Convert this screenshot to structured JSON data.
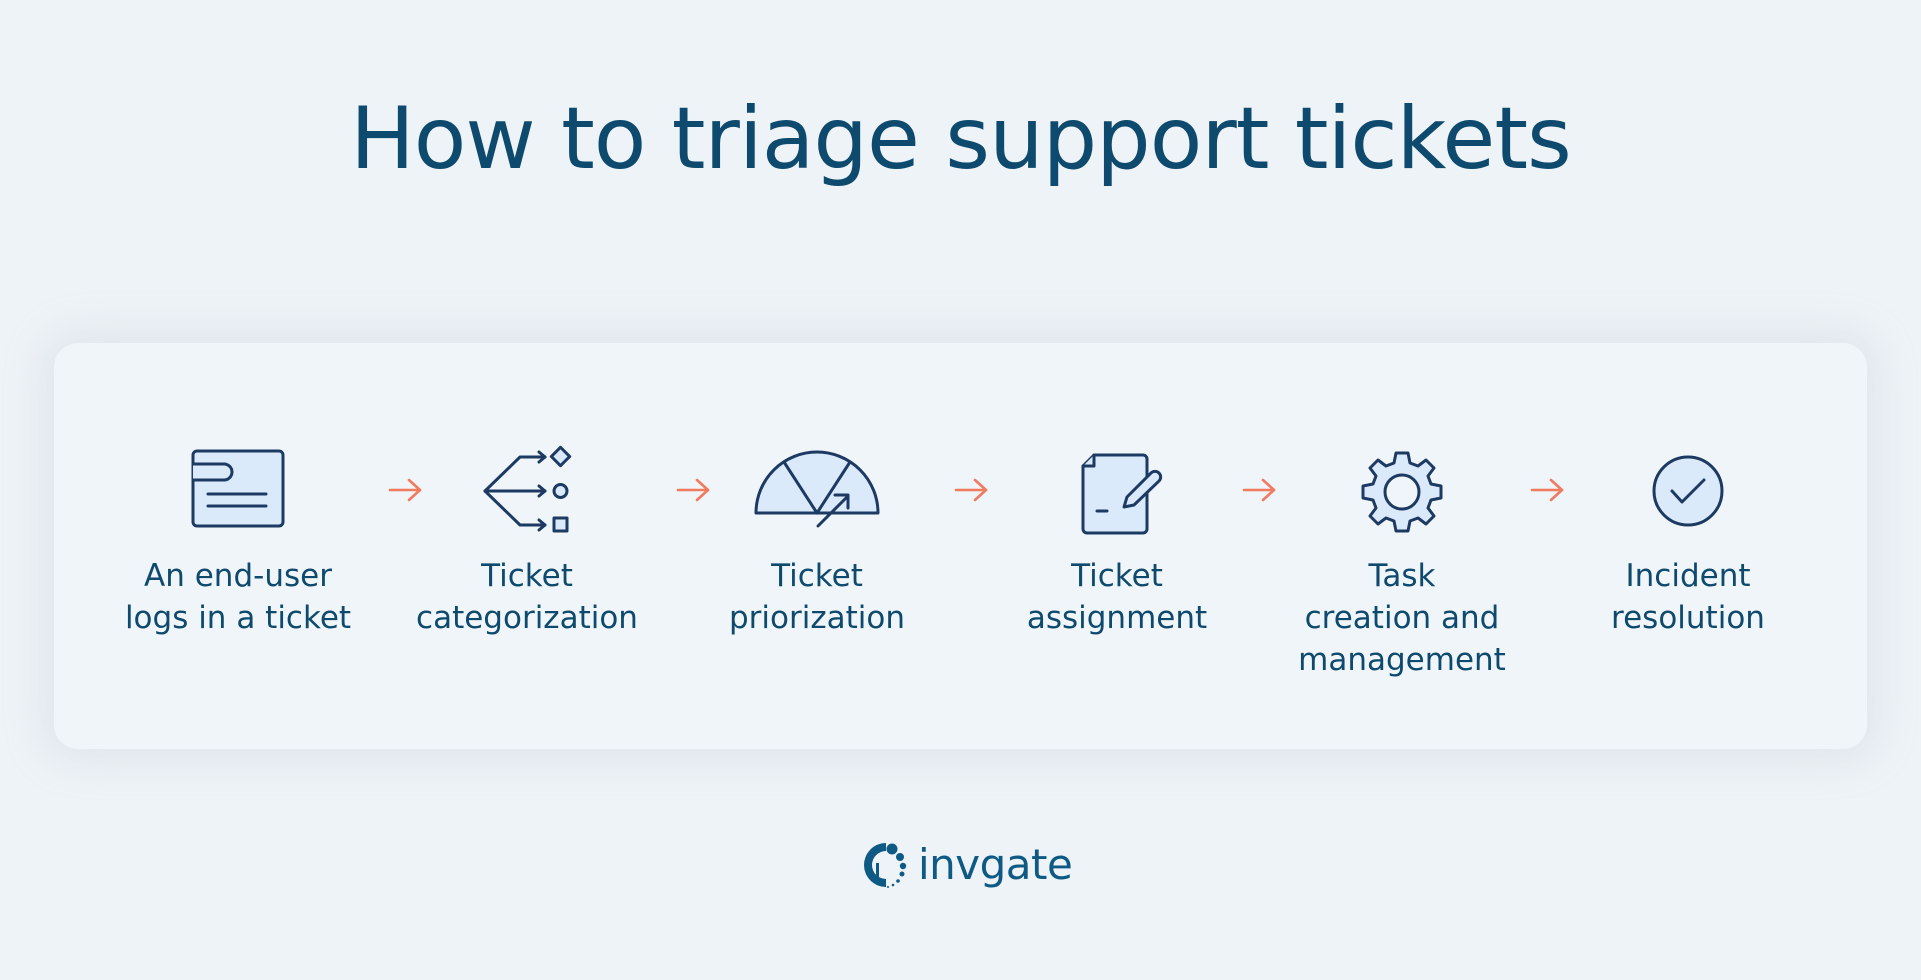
{
  "title": "How to triage support tickets",
  "colors": {
    "text": "#0e4a6e",
    "icon_stroke": "#1d3a63",
    "icon_fill": "#dbeafa",
    "arrow": "#f27a5e",
    "background": "#eef3f7",
    "card": "#f0f5f9",
    "brand": "#0e5a84"
  },
  "steps": [
    {
      "icon": "ticket-form-icon",
      "label": "An end-user\nlogs in a ticket"
    },
    {
      "icon": "categorize-branch-icon",
      "label": "Ticket\ncategorization"
    },
    {
      "icon": "priority-gauge-icon",
      "label": "Ticket\npriorization"
    },
    {
      "icon": "document-pen-icon",
      "label": "Ticket\nassignment"
    },
    {
      "icon": "gear-icon",
      "label": "Task\ncreation and\nmanagement"
    },
    {
      "icon": "check-circle-icon",
      "label": "Incident\nresolution"
    }
  ],
  "connector_icon": "arrow-right-icon",
  "footer": {
    "logo_icon": "invgate-logo-icon",
    "brand_name": "invgate"
  }
}
